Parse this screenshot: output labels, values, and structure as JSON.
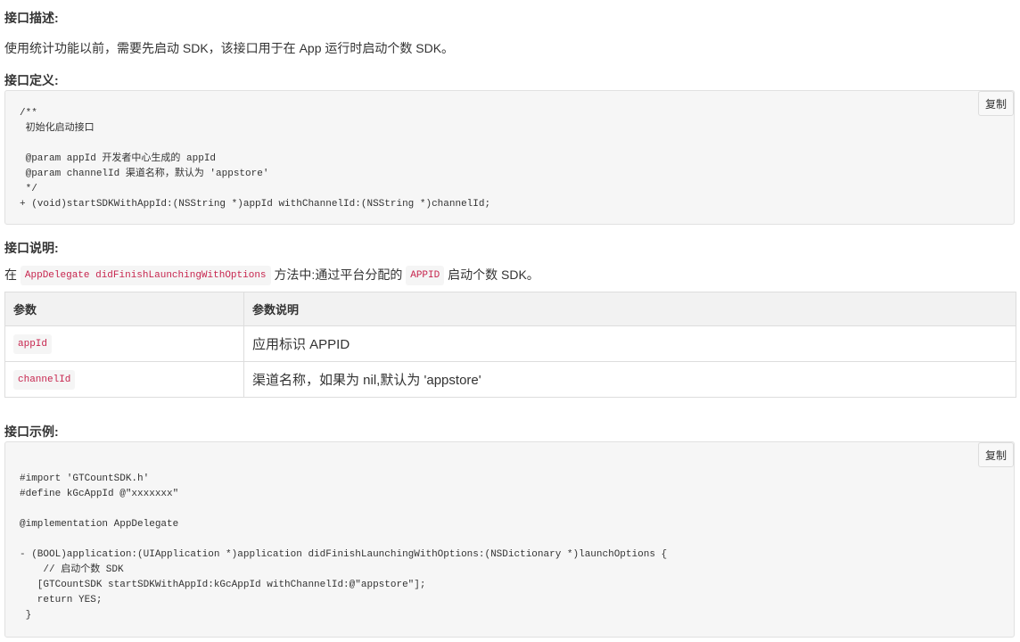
{
  "sections": {
    "desc_heading": "接口描述:",
    "desc_text": "使用统计功能以前，需要先启动 SDK，该接口用于在 App 运行时启动个数 SDK。",
    "def_heading": "接口定义:",
    "def_code": "/**\n 初始化启动接口\n\n @param appId 开发者中心生成的 appId\n @param channelId 渠道名称，默认为 'appstore'\n */\n+ (void)startSDKWithAppId:(NSString *)appId withChannelId:(NSString *)channelId;",
    "copy_label": "复制",
    "note_heading": "接口说明:",
    "note_prefix": "在",
    "note_code1": "AppDelegate didFinishLaunchingWithOptions",
    "note_middle": "方法中:通过平台分配的",
    "note_code2": "APPID",
    "note_suffix": "启动个数 SDK。",
    "example_heading": "接口示例:",
    "example_code": "#import 'GTCountSDK.h'\n#define kGcAppId @\"xxxxxxx\"\n\n@implementation AppDelegate\n\n- (BOOL)application:(UIApplication *)application didFinishLaunchingWithOptions:(NSDictionary *)launchOptions {\n    // 启动个数 SDK\n   [GTCountSDK startSDKWithAppId:kGcAppId withChannelId:@\"appstore\"];\n   return YES;\n }"
  },
  "table": {
    "headers": [
      "参数",
      "参数说明"
    ],
    "rows": [
      {
        "param": "appId",
        "desc": "应用标识 APPID"
      },
      {
        "param": "channelId",
        "desc": "渠道名称，如果为 nil,默认为 'appstore'"
      }
    ]
  }
}
